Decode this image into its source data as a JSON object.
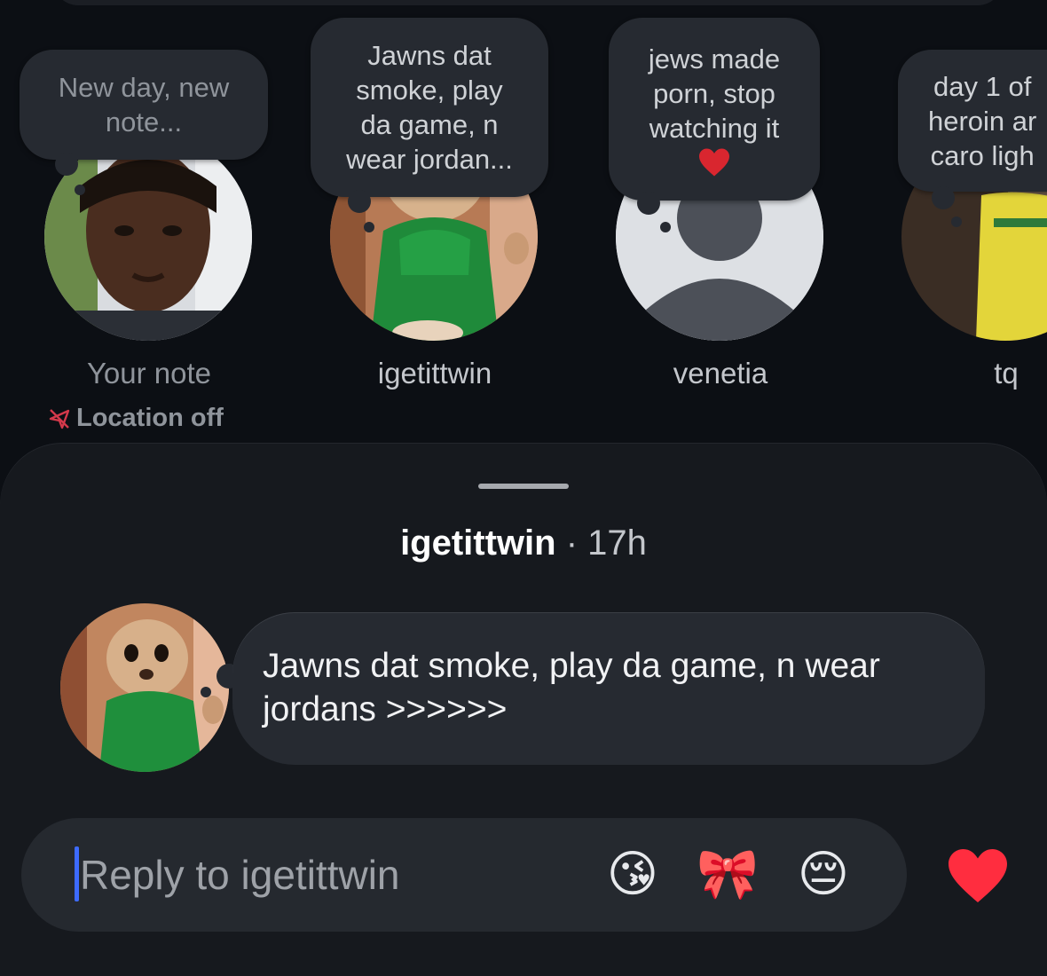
{
  "notes": [
    {
      "text": "New day, new\nnote...",
      "name": "Your note",
      "is_placeholder": true
    },
    {
      "text": "Jawns dat\nsmoke, play\nda game, n\nwear jordan...",
      "name": "igetittwin",
      "is_placeholder": false
    },
    {
      "text": "jews made\nporn, stop\nwatching it",
      "emoji": "heart-emoji",
      "name": "venetia",
      "is_placeholder": false
    },
    {
      "text": "day 1 of\nheroin ar\ncaro ligh",
      "name": "tq",
      "is_placeholder": false
    }
  ],
  "location": {
    "label": "Location off",
    "icon": "location-off-icon"
  },
  "sheet": {
    "author": "igetittwin",
    "separator": "·",
    "time": "17h",
    "message": "Jawns dat smoke, play da game, n wear jordans >>>>>>"
  },
  "reply": {
    "placeholder": "Reply to igetittwin",
    "value": "",
    "quick_reactions": [
      "😘",
      "🎀",
      "😔"
    ],
    "like_icon": "heart-icon"
  },
  "colors": {
    "background": "#0c0f14",
    "sheet": "#16191e",
    "bubble": "#262a31",
    "caret": "#3d6bff",
    "heart": "#ff2d3f"
  }
}
